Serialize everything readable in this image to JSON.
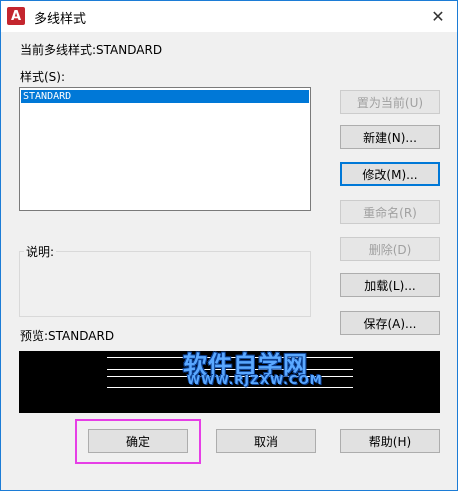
{
  "titlebar": {
    "app_icon": "A",
    "title": "多线样式",
    "close_label": "✕"
  },
  "current_style": {
    "label": "当前多线样式:STANDARD"
  },
  "styles": {
    "label": "样式(S):",
    "items": [
      {
        "name": "STANDARD",
        "selected": true
      }
    ]
  },
  "description": {
    "label": "说明:"
  },
  "preview": {
    "label": "预览:STANDARD"
  },
  "side_buttons": {
    "set_current": "置为当前(U)",
    "new": "新建(N)...",
    "modify": "修改(M)...",
    "rename": "重命名(R)",
    "delete": "删除(D)",
    "load": "加载(L)...",
    "save": "保存(A)..."
  },
  "bottom_buttons": {
    "ok": "确定",
    "cancel": "取消",
    "help": "帮助(H)"
  },
  "watermark": {
    "main": "软件自学网",
    "sub": "WWW.RJZXW.COM"
  },
  "colors": {
    "accent": "#0078d7",
    "app_icon": "#c4262e",
    "highlight": "#e63ee6",
    "window_border": "#1c7cd6"
  }
}
